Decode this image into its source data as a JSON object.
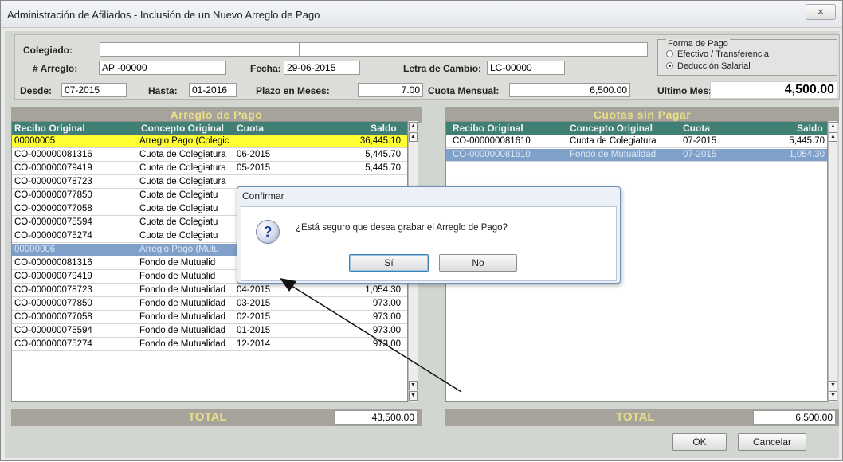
{
  "window": {
    "title": "Administración de Afiliados - Inclusión de un Nuevo Arreglo de Pago",
    "close_label": "⨯"
  },
  "header": {
    "colegiado_label": "Colegiado:",
    "colegiado_value": "",
    "colegiado_name": "",
    "arreglo_label": "# Arreglo:",
    "arreglo_value": "AP -00000",
    "fecha_label": "Fecha:",
    "fecha_value": "29-06-2015",
    "letra_label": "Letra de Cambio:",
    "letra_value": "LC-00000",
    "desde_label": "Desde:",
    "desde_value": "07-2015",
    "hasta_label": "Hasta:",
    "hasta_value": "01-2016",
    "plazo_label": "Plazo en Meses:",
    "plazo_value": "7.00",
    "cuota_label": "Cuota Mensual:",
    "cuota_value": "6,500.00",
    "ultimo_label": "Ultimo Mes:",
    "ultimo_value": "4,500.00"
  },
  "forma_pago": {
    "legend": "Forma de Pago",
    "options": [
      {
        "label": "Efectivo / Transferencia",
        "selected": false
      },
      {
        "label": "Deducción Salarial",
        "selected": true
      }
    ]
  },
  "left_grid": {
    "title": "Arreglo de Pago",
    "columns": [
      "Recibo Original",
      "Concepto Original",
      "Cuota",
      "Saldo"
    ],
    "rows": [
      {
        "recibo": "00000005",
        "concepto": "Arreglo Pago (Colegic",
        "cuota": "",
        "saldo": "36,445.10",
        "style": "yel"
      },
      {
        "recibo": "CO-000000081316",
        "concepto": "Cuota de Colegiatura",
        "cuota": "06-2015",
        "saldo": "5,445.70",
        "style": ""
      },
      {
        "recibo": "CO-000000079419",
        "concepto": "Cuota de Colegiatura",
        "cuota": "05-2015",
        "saldo": "5,445.70",
        "style": ""
      },
      {
        "recibo": "CO-000000078723",
        "concepto": "Cuota de Colegiatura",
        "cuota": "",
        "saldo": "",
        "style": ""
      },
      {
        "recibo": "CO-000000077850",
        "concepto": "Cuota de Colegiatu",
        "cuota": "",
        "saldo": "",
        "style": ""
      },
      {
        "recibo": "CO-000000077058",
        "concepto": "Cuota de Colegiatu",
        "cuota": "",
        "saldo": "",
        "style": ""
      },
      {
        "recibo": "CO-000000075594",
        "concepto": "Cuota de Colegiatu",
        "cuota": "",
        "saldo": "",
        "style": ""
      },
      {
        "recibo": "CO-000000075274",
        "concepto": "Cuota de Colegiatu",
        "cuota": "",
        "saldo": "",
        "style": ""
      },
      {
        "recibo": "00000006",
        "concepto": "Arreglo Pago (Mutu",
        "cuota": "",
        "saldo": "",
        "style": "sel"
      },
      {
        "recibo": "CO-000000081316",
        "concepto": "Fondo de Mutualid",
        "cuota": "",
        "saldo": "",
        "style": ""
      },
      {
        "recibo": "CO-000000079419",
        "concepto": "Fondo de Mutualid",
        "cuota": "",
        "saldo": "",
        "style": ""
      },
      {
        "recibo": "CO-000000078723",
        "concepto": "Fondo de Mutualidad",
        "cuota": "04-2015",
        "saldo": "1,054.30",
        "style": ""
      },
      {
        "recibo": "CO-000000077850",
        "concepto": "Fondo de Mutualidad",
        "cuota": "03-2015",
        "saldo": "973.00",
        "style": ""
      },
      {
        "recibo": "CO-000000077058",
        "concepto": "Fondo de Mutualidad",
        "cuota": "02-2015",
        "saldo": "973.00",
        "style": ""
      },
      {
        "recibo": "CO-000000075594",
        "concepto": "Fondo de Mutualidad",
        "cuota": "01-2015",
        "saldo": "973.00",
        "style": ""
      },
      {
        "recibo": "CO-000000075274",
        "concepto": "Fondo de Mutualidad",
        "cuota": "12-2014",
        "saldo": "973.00",
        "style": ""
      }
    ],
    "total_label": "TOTAL",
    "total_value": "43,500.00"
  },
  "right_grid": {
    "title": "Cuotas sin Pagar",
    "columns": [
      "Recibo Original",
      "Concepto Original",
      "Cuota",
      "Saldo"
    ],
    "rows": [
      {
        "recibo": "CO-000000081610",
        "concepto": "Cuota de Colegiatura",
        "cuota": "07-2015",
        "saldo": "5,445.70",
        "style": ""
      },
      {
        "recibo": "CO-000000081610",
        "concepto": "Fondo de Mutualidad",
        "cuota": "07-2015",
        "saldo": "1,054.30",
        "style": "sel"
      }
    ],
    "total_label": "TOTAL",
    "total_value": "6,500.00"
  },
  "buttons": {
    "ok": "OK",
    "cancel": "Cancelar"
  },
  "dialog": {
    "title": "Confirmar",
    "message": "¿Está seguro que desea grabar el Arreglo de Pago?",
    "icon": "question-icon",
    "icon_glyph": "?",
    "yes": "Sí",
    "no": "No"
  },
  "scroll_glyphs": {
    "up": "▲",
    "down": "▼"
  }
}
